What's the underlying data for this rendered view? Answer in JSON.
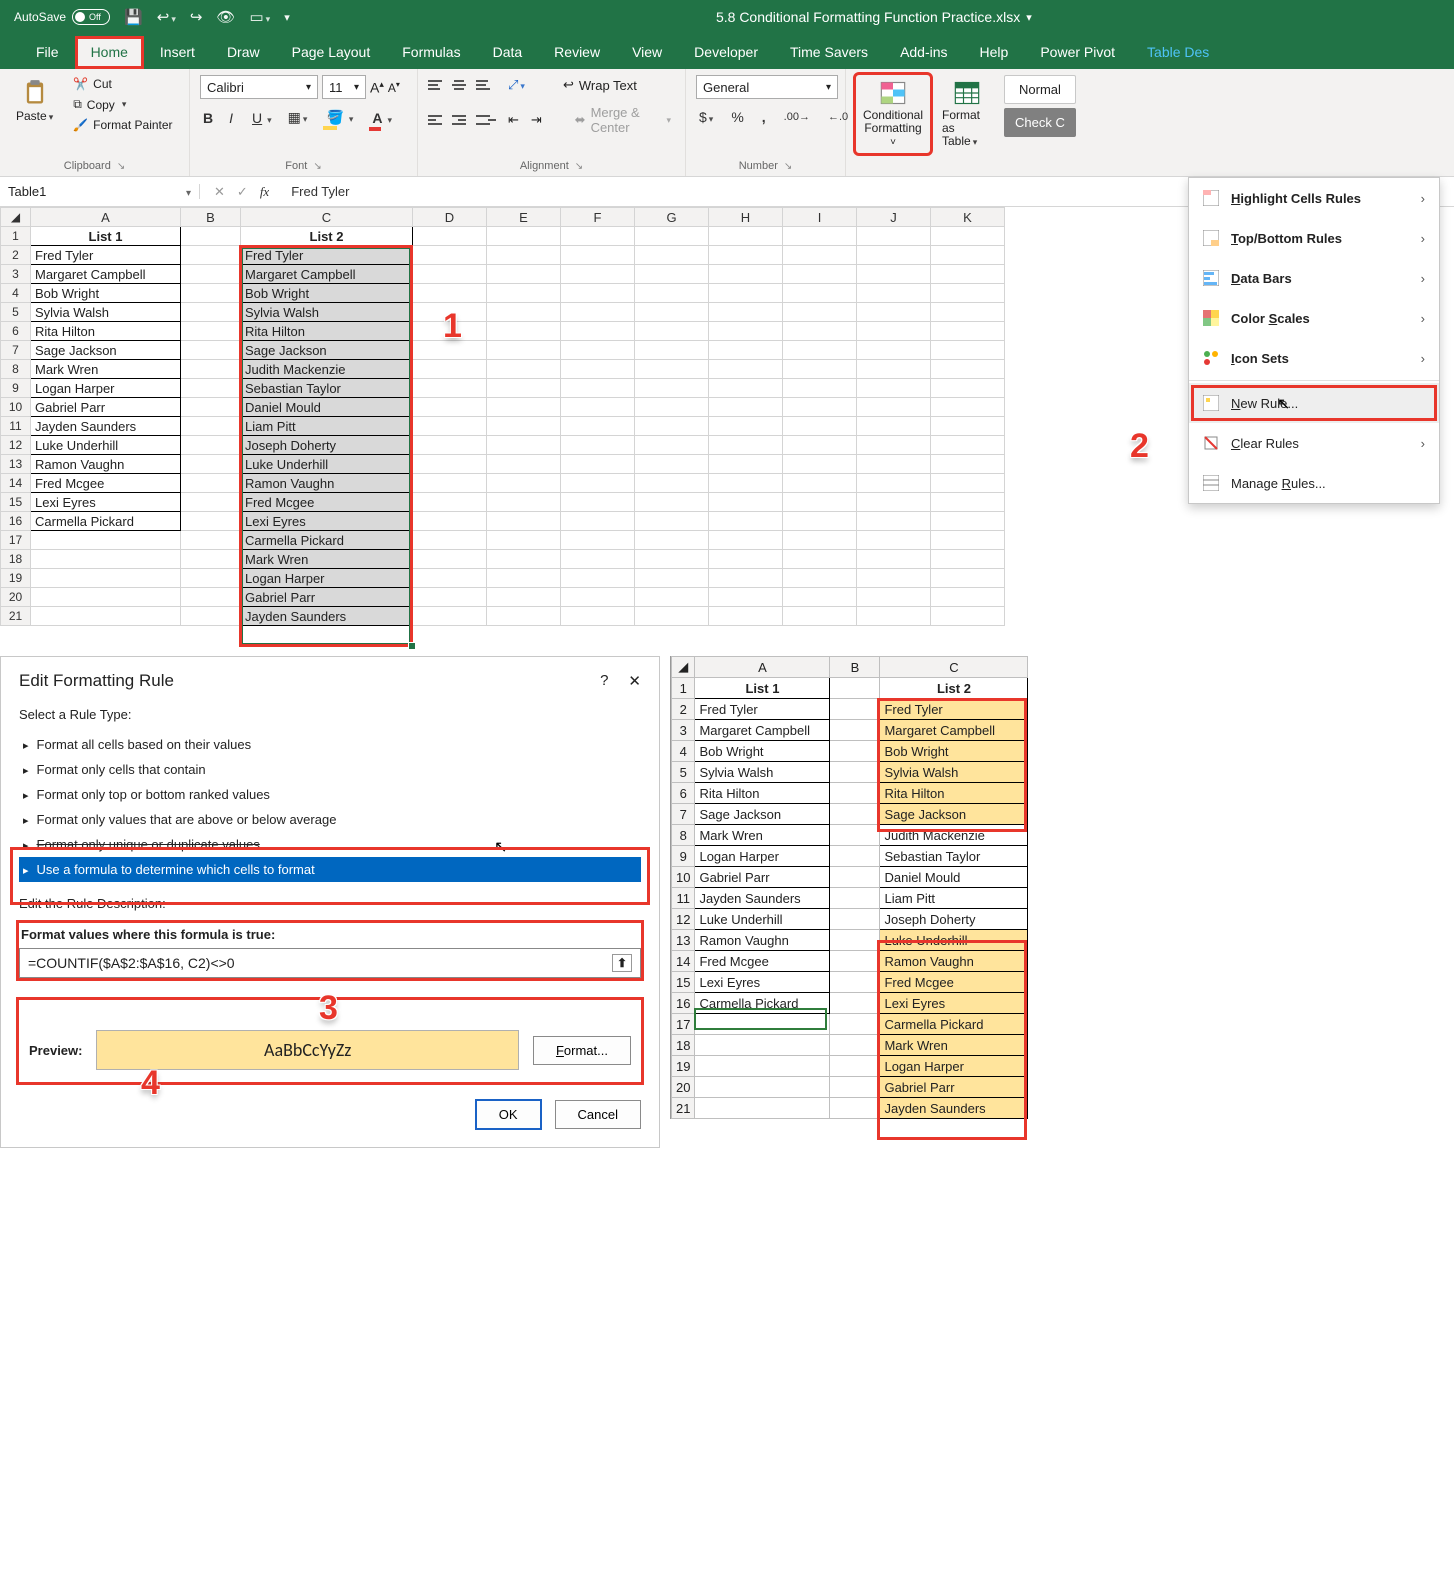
{
  "titlebar": {
    "autosave_label": "AutoSave",
    "autosave_state": "Off",
    "filename": "5.8 Conditional Formatting Function Practice.xlsx"
  },
  "tabs": [
    "File",
    "Home",
    "Insert",
    "Draw",
    "Page Layout",
    "Formulas",
    "Data",
    "Review",
    "View",
    "Developer",
    "Time Savers",
    "Add-ins",
    "Help",
    "Power Pivot",
    "Table Des"
  ],
  "ribbon": {
    "clipboard": {
      "paste": "Paste",
      "cut": "Cut",
      "copy": "Copy",
      "format_painter": "Format Painter",
      "group": "Clipboard"
    },
    "font": {
      "name": "Calibri",
      "size": "11",
      "group": "Font"
    },
    "alignment": {
      "wrap": "Wrap Text",
      "merge": "Merge & Center",
      "group": "Alignment"
    },
    "number": {
      "format": "General",
      "group": "Number"
    },
    "styles": {
      "cond_fmt": "Conditional Formatting",
      "fmt_table": "Format as Table",
      "normal": "Normal",
      "check_cell": "Check C"
    }
  },
  "cf_menu": {
    "highlight": "Highlight Cells Rules",
    "topbottom": "Top/Bottom Rules",
    "databars": "Data Bars",
    "scales": "Color Scales",
    "icons": "Icon Sets",
    "newrule": "New Rule...",
    "clear": "Clear Rules",
    "manage": "Manage Rules..."
  },
  "fx": {
    "namebox": "Table1",
    "value": "Fred Tyler"
  },
  "grid": {
    "cols": [
      "A",
      "B",
      "C",
      "D",
      "E",
      "F",
      "G",
      "H",
      "I",
      "J",
      "K"
    ],
    "headers": {
      "a": "List 1",
      "c": "List 2"
    },
    "listA": [
      "Fred Tyler",
      "Margaret Campbell",
      "Bob Wright",
      "Sylvia Walsh",
      "Rita Hilton",
      "Sage Jackson",
      "Mark Wren",
      "Logan Harper",
      "Gabriel Parr",
      "Jayden Saunders",
      "Luke Underhill",
      "Ramon Vaughn",
      "Fred Mcgee",
      "Lexi Eyres",
      "Carmella Pickard"
    ],
    "listC": [
      "Fred Tyler",
      "Margaret Campbell",
      "Bob Wright",
      "Sylvia Walsh",
      "Rita Hilton",
      "Sage Jackson",
      "Judith Mackenzie",
      "Sebastian Taylor",
      "Daniel Mould",
      "Liam Pitt",
      "Joseph Doherty",
      "Luke Underhill",
      "Ramon Vaughn",
      "Fred Mcgee",
      "Lexi Eyres",
      "Carmella Pickard",
      "Mark Wren",
      "Logan Harper",
      "Gabriel Parr",
      "Jayden Saunders"
    ]
  },
  "dialog": {
    "title": "Edit Formatting Rule",
    "select_label": "Select a Rule Type:",
    "types": [
      "Format all cells based on their values",
      "Format only cells that contain",
      "Format only top or bottom ranked values",
      "Format only values that are above or below average",
      "Format only unique or duplicate values",
      "Use a formula to determine which cells to format"
    ],
    "edit_label": "Edit the Rule Description:",
    "formula_label": "Format values where this formula is true:",
    "formula": "=COUNTIF($A$2:$A$16, C2)<>0",
    "preview_label": "Preview:",
    "preview_text": "AaBbCcYyZz",
    "format_btn": "Format...",
    "ok": "OK",
    "cancel": "Cancel"
  },
  "result": {
    "cols": [
      "A",
      "B",
      "C"
    ],
    "headers": {
      "a": "List 1",
      "c": "List 2"
    },
    "listA": [
      "Fred Tyler",
      "Margaret Campbell",
      "Bob Wright",
      "Sylvia Walsh",
      "Rita Hilton",
      "Sage Jackson",
      "Mark Wren",
      "Logan Harper",
      "Gabriel Parr",
      "Jayden Saunders",
      "Luke Underhill",
      "Ramon Vaughn",
      "Fred Mcgee",
      "Lexi Eyres",
      "Carmella Pickard"
    ],
    "listC": [
      {
        "v": "Fred Tyler",
        "hl": true
      },
      {
        "v": "Margaret Campbell",
        "hl": true
      },
      {
        "v": "Bob Wright",
        "hl": true
      },
      {
        "v": "Sylvia Walsh",
        "hl": true
      },
      {
        "v": "Rita Hilton",
        "hl": true
      },
      {
        "v": "Sage Jackson",
        "hl": true
      },
      {
        "v": "Judith Mackenzie",
        "hl": false
      },
      {
        "v": "Sebastian Taylor",
        "hl": false
      },
      {
        "v": "Daniel Mould",
        "hl": false
      },
      {
        "v": "Liam Pitt",
        "hl": false
      },
      {
        "v": "Joseph Doherty",
        "hl": false
      },
      {
        "v": "Luke Underhill",
        "hl": true
      },
      {
        "v": "Ramon Vaughn",
        "hl": true
      },
      {
        "v": "Fred Mcgee",
        "hl": true
      },
      {
        "v": "Lexi Eyres",
        "hl": true
      },
      {
        "v": "Carmella Pickard",
        "hl": true
      },
      {
        "v": "Mark Wren",
        "hl": true
      },
      {
        "v": "Logan Harper",
        "hl": true
      },
      {
        "v": "Gabriel Parr",
        "hl": true
      },
      {
        "v": "Jayden Saunders",
        "hl": true
      }
    ]
  },
  "annotations": {
    "a1": "1",
    "a2": "2",
    "a3": "3",
    "a4": "4"
  }
}
